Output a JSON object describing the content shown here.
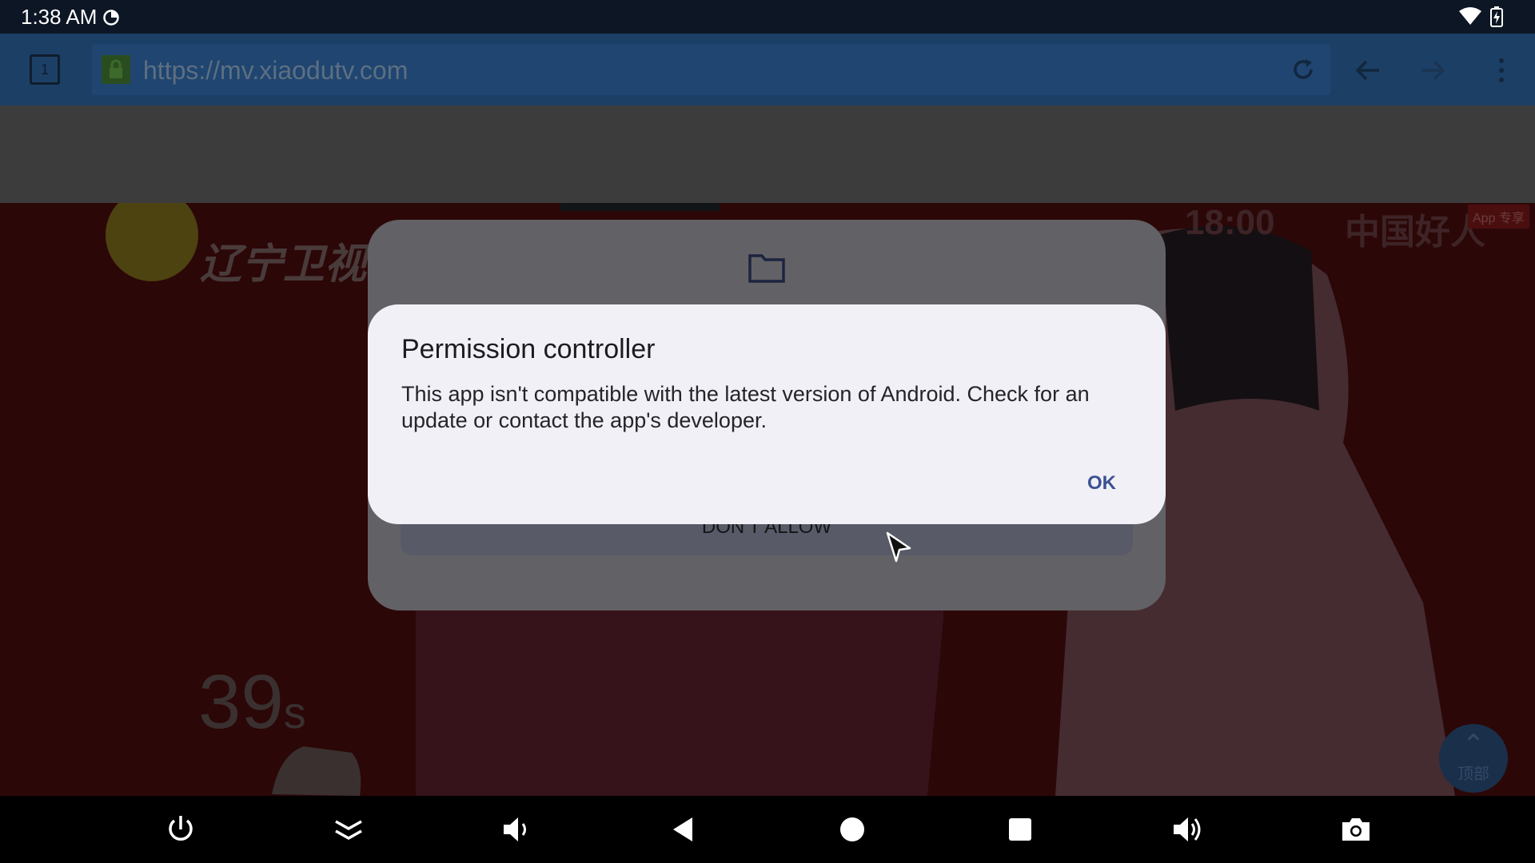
{
  "status_bar": {
    "time": "1:38 AM",
    "icons": [
      "data-saver-icon",
      "wifi-icon",
      "battery-icon"
    ]
  },
  "browser": {
    "tab_count": "1",
    "url": "https://mv.xiaodutv.com",
    "icons": [
      "lock-icon",
      "reload-icon",
      "back-arrow-icon",
      "forward-arrow-icon",
      "overflow-menu-icon"
    ]
  },
  "video": {
    "channel_logo": "辽宁卫视",
    "clock": "18:00",
    "program_title": "中国好人",
    "app_badge": "App 专享",
    "countdown_value": "39",
    "countdown_unit": "s",
    "top_button_label": "顶部"
  },
  "permission_dialog": {
    "icon": "folder-icon",
    "deny_label": "DON’T ALLOW"
  },
  "alert_dialog": {
    "title": "Permission controller",
    "message": "This app isn't compatible with the latest version of Android. Check for an update or contact the app's developer.",
    "ok_label": "OK"
  },
  "nav_bar": {
    "buttons": [
      "power-icon",
      "collapse-icon",
      "volume-down-icon",
      "back-icon",
      "home-icon",
      "recents-icon",
      "volume-up-icon",
      "camera-icon"
    ]
  },
  "colors": {
    "status_bar_bg": "#0c1624",
    "browser_bar_bg": "#1c3f66",
    "dialog_bg": "#f1f0f6",
    "accent": "#3c5194"
  }
}
